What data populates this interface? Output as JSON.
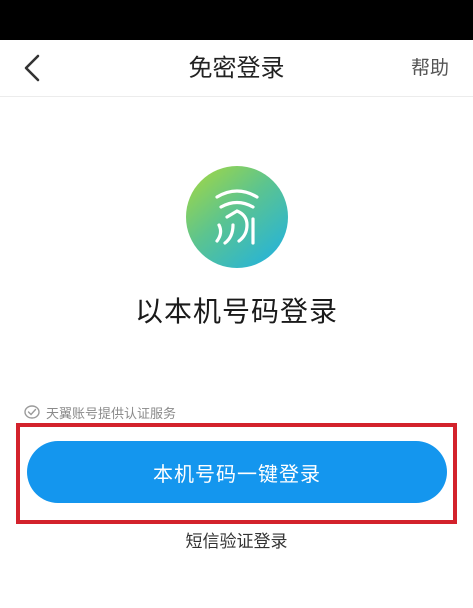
{
  "header": {
    "title": "免密登录",
    "help_label": "帮助",
    "back_icon": "chevron-left-icon"
  },
  "logo": {
    "icon": "fingerprint-icon",
    "gradient_colors": [
      "#a9d93c",
      "#5cc48f",
      "#1cb0e6"
    ]
  },
  "main": {
    "subtitle": "以本机号码登录",
    "provider_note": "天翼账号提供认证服务",
    "provider_icon": "shield-check-icon",
    "primary_button_label": "本机号码一键登录",
    "sms_login_label": "短信验证登录"
  },
  "colors": {
    "primary": "#1496ee",
    "highlight_border": "#d3222c",
    "status_bar": "#000000"
  }
}
